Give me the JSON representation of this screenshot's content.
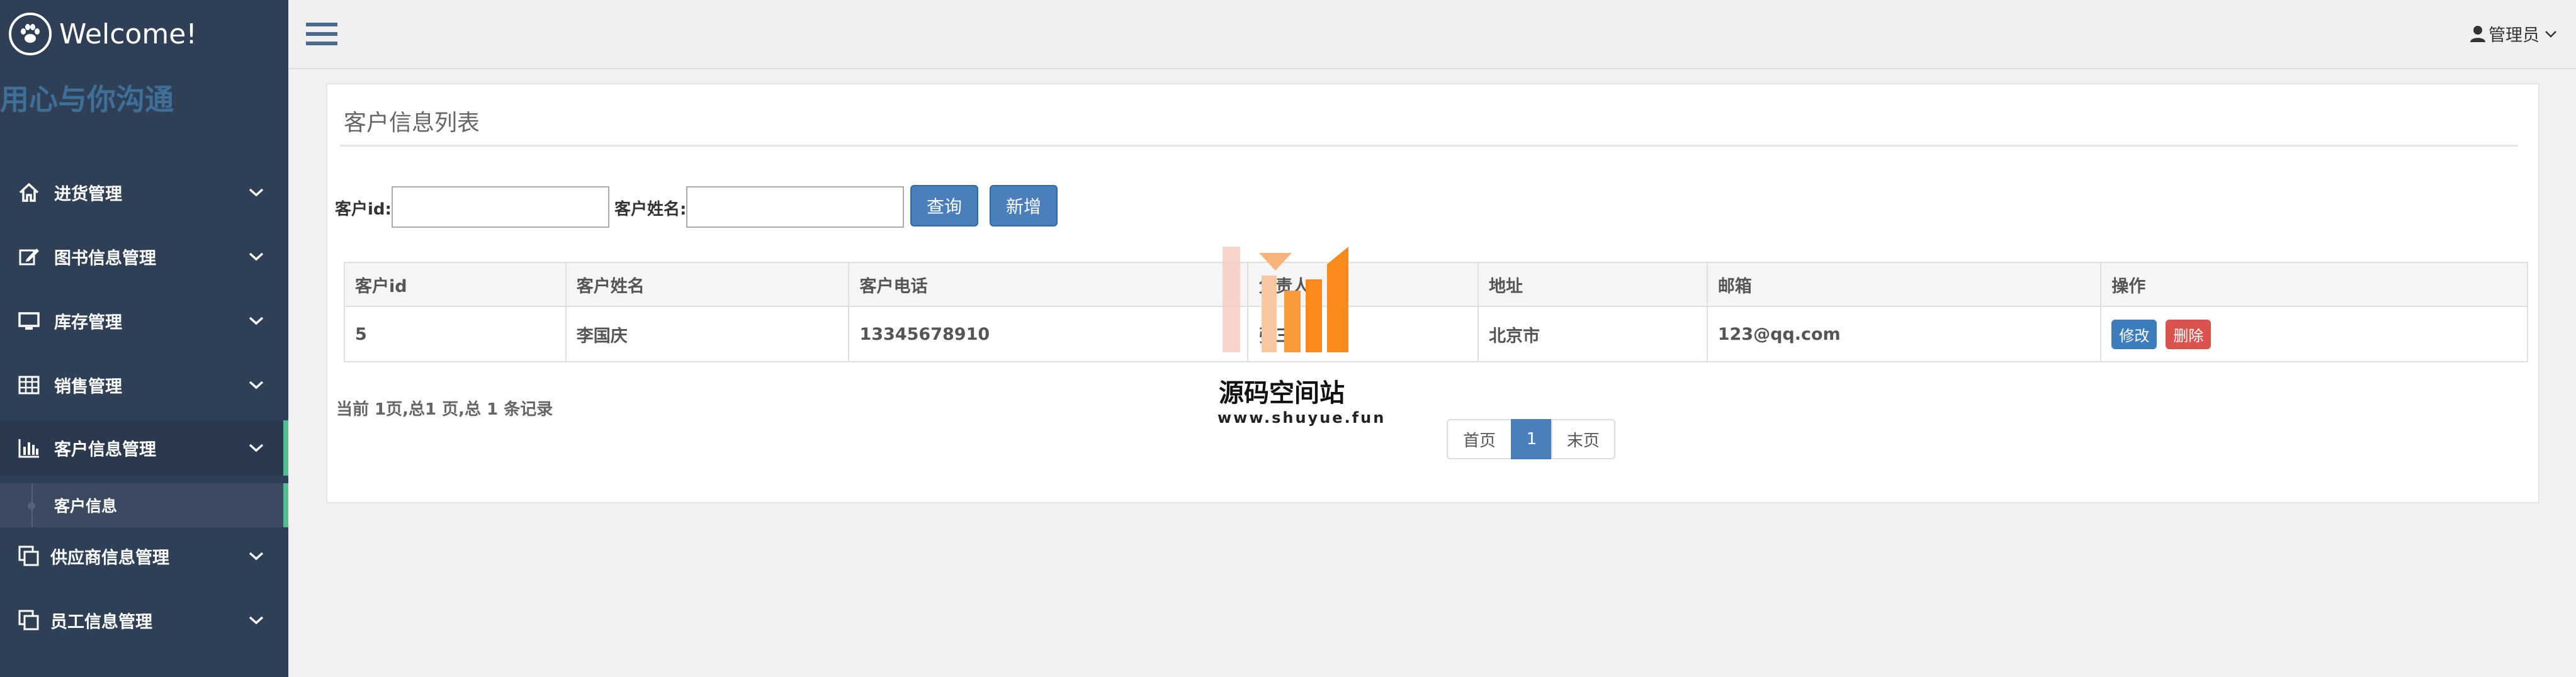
{
  "sidebar": {
    "brand": "Welcome!",
    "slogan": "用心与你沟通",
    "items": [
      {
        "label": "进货管理",
        "icon": "home-icon"
      },
      {
        "label": "图书信息管理",
        "icon": "edit-icon"
      },
      {
        "label": "库存管理",
        "icon": "monitor-icon"
      },
      {
        "label": "销售管理",
        "icon": "table-icon"
      },
      {
        "label": "客户信息管理",
        "icon": "bar-chart-icon",
        "active": true
      },
      {
        "label": "供应商信息管理",
        "icon": "copy-icon"
      },
      {
        "label": "员工信息管理",
        "icon": "copy-icon"
      }
    ],
    "sub_item": "客户信息"
  },
  "header": {
    "user": "管理员"
  },
  "panel": {
    "title": "客户信息列表",
    "search": {
      "id_label": "客户id:",
      "id_value": "",
      "name_label": "客户姓名:",
      "name_value": "",
      "query_button": "查询",
      "add_button": "新增"
    },
    "table": {
      "columns": [
        "客户id",
        "客户姓名",
        "客户电话",
        "负责人",
        "地址",
        "邮箱",
        "操作"
      ],
      "rows": [
        {
          "id": "5",
          "name": "李国庆",
          "phone": "13345678910",
          "manager": "张三",
          "address": "北京市",
          "email": "123@qq.com",
          "edit": "修改",
          "delete": "删除"
        }
      ]
    },
    "page_info": "当前 1页,总1 页,总 1 条记录",
    "pagination": {
      "first": "首页",
      "current": "1",
      "last": "末页"
    }
  },
  "watermark": {
    "title": "源码空间站",
    "url": "www.shuyue.fun"
  },
  "colors": {
    "sidebar_bg": "#2f4056",
    "accent_green": "#4fc08d",
    "primary_button": "#4a7fbc",
    "danger": "#d9534f"
  }
}
